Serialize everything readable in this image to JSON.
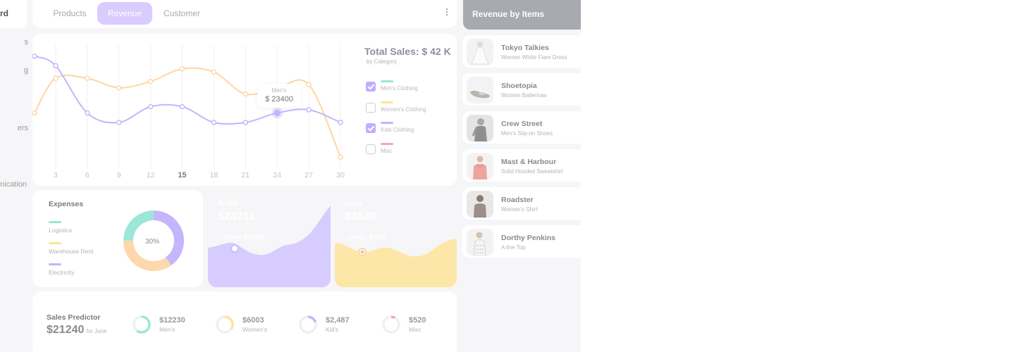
{
  "sidebar": {
    "brand_label": "ard",
    "items": [
      "s",
      "g",
      "ers",
      "nication"
    ]
  },
  "tabs": [
    "Products",
    "Revenue",
    "Customer"
  ],
  "active_tab": "Revenue",
  "sales_chart": {
    "title": "Total Sales: $ 42 K",
    "subtitle": "by Category",
    "legend": [
      {
        "label": "Men's Clothing",
        "color": "#9be7d8",
        "checked": true
      },
      {
        "label": "Women's Clothing",
        "color": "#fde49c",
        "checked": false
      },
      {
        "label": "Kids Clothing",
        "color": "#c4b5fd",
        "checked": true
      },
      {
        "label": "Misc",
        "color": "#fda4af",
        "checked": false
      }
    ],
    "tooltip": {
      "category": "Men's",
      "value": "$ 23400"
    }
  },
  "chart_data": {
    "type": "line",
    "x_ticks": [
      "3",
      "6",
      "9",
      "12",
      "15",
      "18",
      "21",
      "24",
      "27",
      "30"
    ],
    "highlighted_tick": "15",
    "grid": "vertical",
    "series": [
      {
        "color": "#c4b5fd",
        "x": [
          1,
          3,
          6,
          9,
          12,
          15,
          18,
          21,
          24,
          27,
          30
        ],
        "y": [
          41,
          38,
          23,
          20,
          25,
          25,
          20,
          20,
          23,
          24,
          20
        ]
      },
      {
        "color": "#fed7a0",
        "x": [
          1,
          3,
          6,
          9,
          12,
          15,
          18,
          21,
          24,
          27,
          30
        ],
        "y": [
          23,
          34,
          34,
          31,
          33,
          37,
          36,
          29,
          31,
          32,
          9
        ]
      }
    ]
  },
  "expenses": {
    "title": "Expenses",
    "items": [
      {
        "label": "Logistics",
        "color": "#9be7d8"
      },
      {
        "label": "Warehouse Rent",
        "color": "#fde49c"
      },
      {
        "label": "Electricity",
        "color": "#c4b5fd"
      }
    ],
    "donut_center": "30%",
    "donut": [
      {
        "color": "#c4b5fd",
        "fraction": 0.4
      },
      {
        "color": "#fed7aa",
        "fraction": 0.35
      },
      {
        "color": "#9be7d8",
        "fraction": 0.25
      }
    ]
  },
  "profit": {
    "title": "Profit",
    "value": "$24211",
    "june": "June: $6430",
    "color": "#d6ccff"
  },
  "loss": {
    "title": "Loss",
    "value": "$3530",
    "june": "June: $252",
    "color": "#fde7a8"
  },
  "predictor": {
    "title": "Sales Predictor",
    "value": "$21240",
    "for_label": "for June",
    "items": [
      {
        "amount": "$12230",
        "label": "Men's",
        "color": "#9be7d8",
        "fraction": 0.6
      },
      {
        "amount": "$6003",
        "label": "Women's",
        "color": "#fde49c",
        "fraction": 0.35
      },
      {
        "amount": "$2,487",
        "label": "Kid's",
        "color": "#c4b5fd",
        "fraction": 0.2
      },
      {
        "amount": "$520",
        "label": "Misc",
        "color": "#fda4af",
        "fraction": 0.08
      }
    ]
  },
  "revenue_items": {
    "title": "Revenue by Items",
    "items": [
      {
        "name": "Tokyo Talkies",
        "desc": " Women White Flare Dress",
        "icon": "dress-icon"
      },
      {
        "name": "Shoetopia",
        "desc": "Women Ballerinas",
        "icon": "shoe-icon"
      },
      {
        "name": "Crew Street",
        "desc": " Men's Slip-on Shoes",
        "icon": "person-icon"
      },
      {
        "name": "Mast & Harbour",
        "desc": "Solid Hooded Sweatshirt",
        "icon": "sweatshirt-icon"
      },
      {
        "name": "Roadster",
        "desc": "Women's Shirt",
        "icon": "shirt-icon"
      },
      {
        "name": "Dorthy Penkins",
        "desc": "A line Top",
        "icon": "top-icon"
      }
    ]
  }
}
